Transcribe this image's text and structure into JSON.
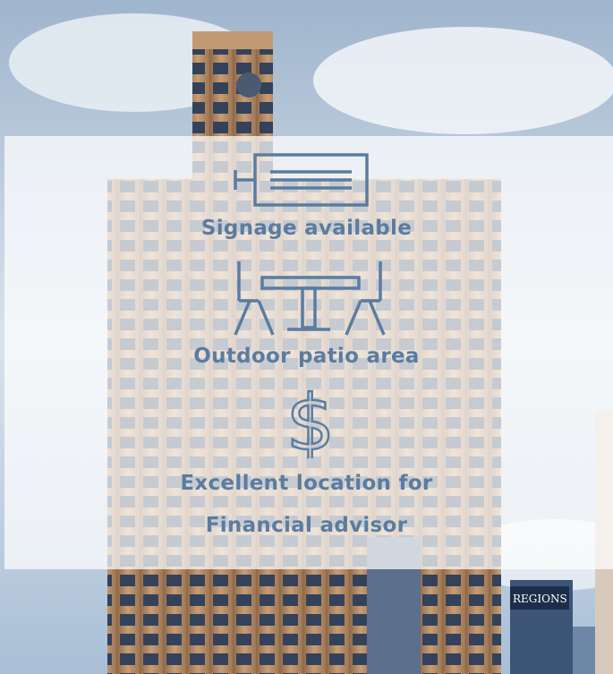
{
  "features": [
    {
      "label": "Signage available",
      "icon": "sign-icon"
    },
    {
      "label": "Outdoor patio area",
      "icon": "patio-table-icon"
    },
    {
      "label": "Excellent location for",
      "icon": "dollar-icon"
    }
  ],
  "features_extra_line": "Financial advisor",
  "colors": {
    "accent": "#5a7ca0",
    "sky": "#b9c9dc",
    "building": "#b58a63"
  },
  "background_building_sign": "REGIONS"
}
